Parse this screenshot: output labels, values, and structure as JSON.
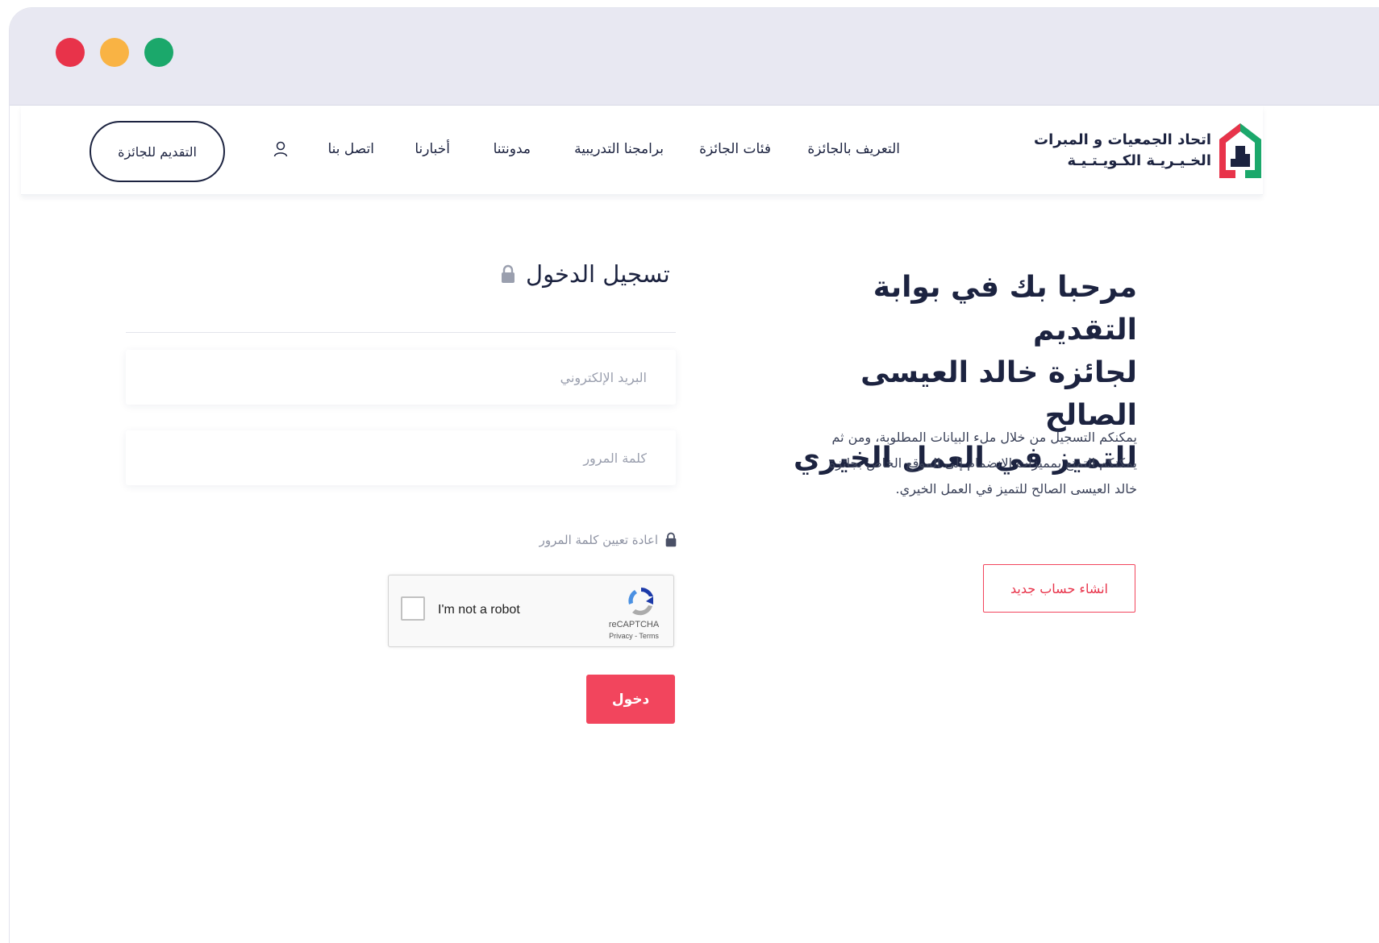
{
  "window": {
    "controls": [
      "close",
      "minimize",
      "maximize"
    ]
  },
  "logo": {
    "line1": "اتحاد الجمعيات و المبرات",
    "line2": "الخـيـريـة الكـويـتـيـة",
    "colors": {
      "green": "#1ba86b",
      "red": "#e8334a",
      "navy": "#1c2340"
    }
  },
  "nav": {
    "items": [
      {
        "label": "التعريف بالجائزة"
      },
      {
        "label": "فئات الجائزة"
      },
      {
        "label": "برامجنا التدريبية"
      },
      {
        "label": "مدونتنا"
      },
      {
        "label": "أخبارنا"
      },
      {
        "label": "اتصل بنا"
      }
    ],
    "user_icon": "user-icon",
    "cta_label": "التقديم للجائزة"
  },
  "hero": {
    "title_line1": "مرحبا بك في بوابة التقديم",
    "title_line2": "لجائزة خالد العيسى الصالح",
    "title_line3": "للتميز في العمل الخيري",
    "description": "يمكنكم التسجيل من خلال ملء البيانات المطلوبة، ومن ثم يمكنكم التمتع بمميزات الانضمام إلى الموقع الخاص بجائزة خالد العيسى الصالح للتميز في العمل الخيري.",
    "signup_label": "انشاء حساب جديد"
  },
  "login": {
    "title": "تسجيل الدخول",
    "email_placeholder": "البريد الإلكتروني",
    "password_placeholder": "كلمة المرور",
    "reset_label": "اعادة تعيين كلمة المرور",
    "submit_label": "دخول"
  },
  "recaptcha": {
    "label": "I'm not a robot",
    "brand": "reCAPTCHA",
    "links": "Privacy - Terms"
  },
  "colors": {
    "accent": "#f2455d",
    "text": "#1c2340",
    "muted": "#9a9fae"
  }
}
